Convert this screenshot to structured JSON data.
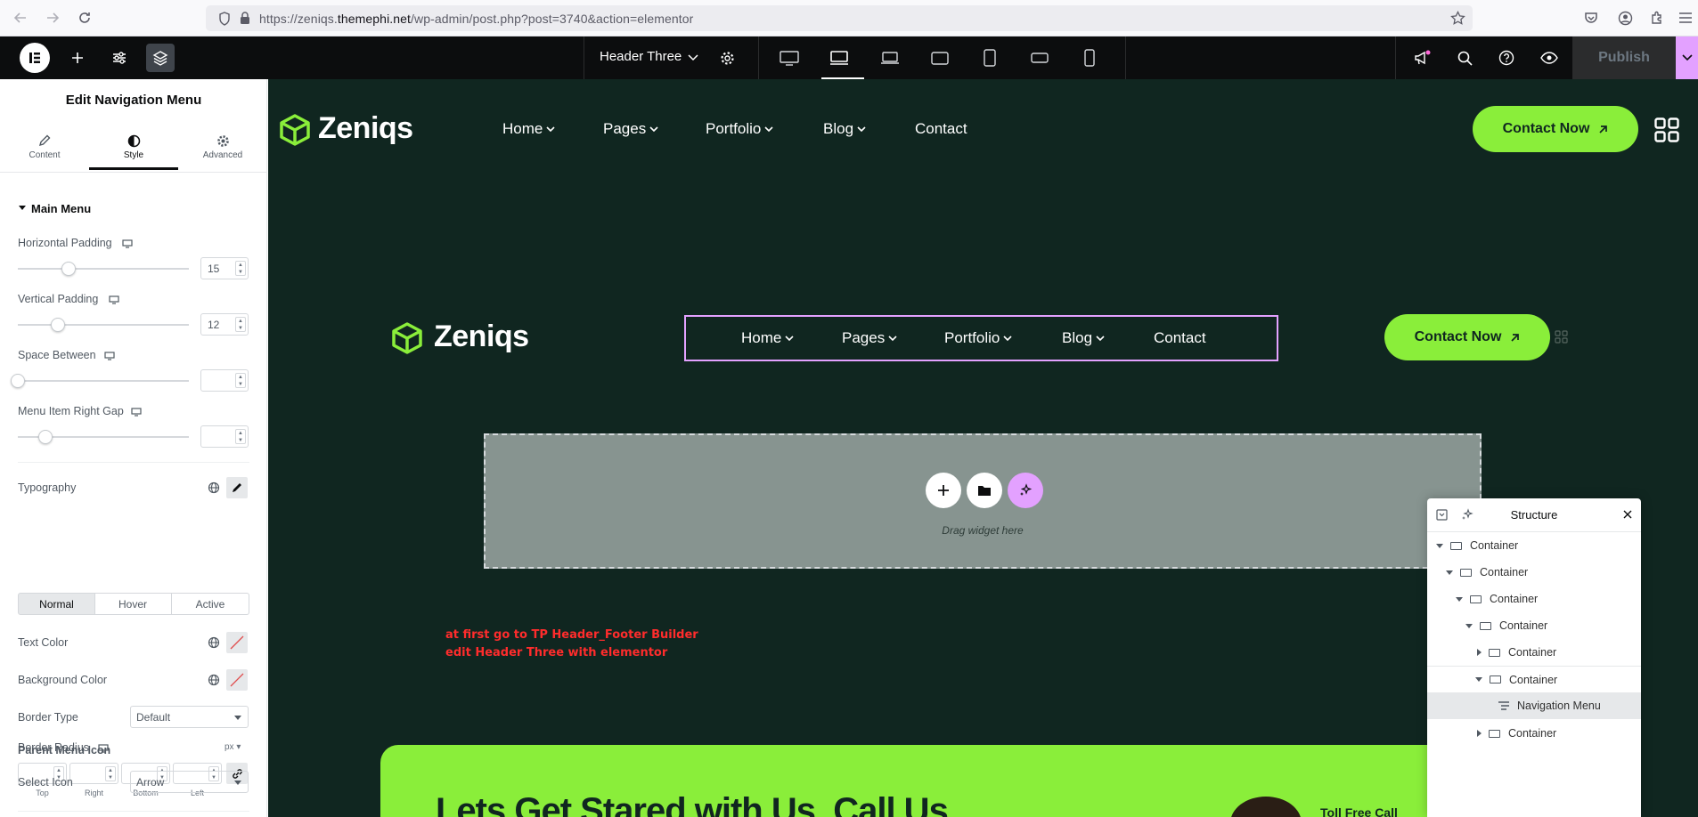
{
  "browser": {
    "url_prefix": "https://zeniqs.",
    "url_domain": "themephi.net",
    "url_path": "/wp-admin/post.php?post=3740&action=elementor"
  },
  "topbar": {
    "document_name": "Header Three",
    "publish_label": "Publish"
  },
  "panel": {
    "title": "Edit Navigation Menu",
    "tabs": [
      {
        "label": "Content",
        "icon": "pencil-icon"
      },
      {
        "label": "Style",
        "icon": "contrast-icon"
      },
      {
        "label": "Advanced",
        "icon": "gear-icon"
      }
    ],
    "section_title": "Main Menu",
    "controls": {
      "horizontal_padding": {
        "label": "Horizontal Padding",
        "value": "15"
      },
      "vertical_padding": {
        "label": "Vertical Padding",
        "value": "12"
      },
      "space_between": {
        "label": "Space Between",
        "value": ""
      },
      "menu_item_right_gap": {
        "label": "Menu Item Right Gap",
        "value": ""
      },
      "typography": {
        "label": "Typography"
      },
      "states": [
        "Normal",
        "Hover",
        "Active"
      ],
      "text_color": {
        "label": "Text Color"
      },
      "background_color": {
        "label": "Background Color"
      },
      "border_type": {
        "label": "Border Type",
        "value": "Default"
      },
      "border_radius": {
        "label": "Border Radius",
        "unit": "px",
        "sides": [
          "Top",
          "Right",
          "Bottom",
          "Left"
        ]
      },
      "parent_menu_icon": {
        "label": "Parent Menu Icon"
      },
      "select_icon": {
        "label": "Select Icon",
        "value": "Arrow"
      }
    }
  },
  "site": {
    "logo_text": "Zeniqs",
    "menu": [
      "Home",
      "Pages",
      "Portfolio",
      "Blog",
      "Contact"
    ],
    "cta_label": "Contact Now",
    "dropzone_text": "Drag widget here",
    "note_line1": "at first go to TP Header_Footer Builder",
    "note_line2": "edit Header Three with elementor",
    "band_title": "Lets Get Stared with Us, Call Us",
    "band_side_text": "Toll Free Call"
  },
  "structure": {
    "title": "Structure",
    "rows": [
      {
        "label": "Container",
        "expanded": true
      },
      {
        "label": "Container",
        "expanded": true
      },
      {
        "label": "Container",
        "expanded": true
      },
      {
        "label": "Container",
        "expanded": true
      },
      {
        "label": "Container",
        "expanded": false
      },
      {
        "label": "Container",
        "expanded": true
      },
      {
        "label": "Navigation Menu",
        "selected": true
      },
      {
        "label": "Container",
        "expanded": false
      }
    ]
  },
  "colors": {
    "accent_green": "#8aee3a",
    "canvas_bg": "#102620",
    "editor_pink": "#e3a1ff",
    "note_red": "#ff2c2c"
  }
}
